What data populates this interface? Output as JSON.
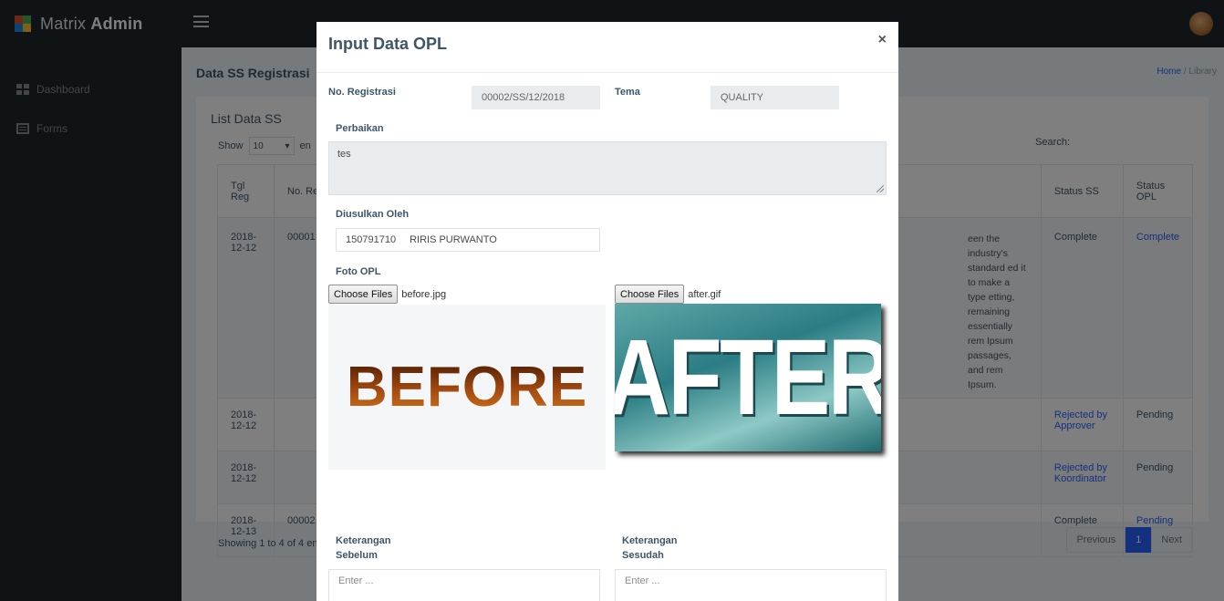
{
  "app": {
    "logo_light": "Matrix",
    "logo_bold": "Admin"
  },
  "sidebar": {
    "items": [
      {
        "label": "Dashboard"
      },
      {
        "label": "Forms"
      }
    ]
  },
  "page": {
    "title": "Data SS Registrasi",
    "breadcrumb": {
      "home": "Home",
      "sep": "/",
      "current": "Library"
    },
    "card_title": "List Data SS",
    "show_label": "Show",
    "entries_value": "10",
    "entries_suffix": "en",
    "search_label": "Search:",
    "table": {
      "headers": [
        "Tgl Reg",
        "No. Re",
        "",
        "Status SS",
        "Status OPL"
      ],
      "rows": [
        {
          "date": "2018-12-12",
          "no": "00001",
          "desc": "een the industry's standard ed it to make a type etting, remaining essentially rem Ipsum passages, and rem Ipsum.",
          "status_ss": "Complete",
          "status_opl": "Complete"
        },
        {
          "date": "2018-12-12",
          "no": "",
          "desc": "",
          "status_ss": "Rejected by Approver",
          "status_opl": "Pending"
        },
        {
          "date": "2018-12-12",
          "no": "",
          "desc": "",
          "status_ss": "Rejected by Koordinator",
          "status_opl": "Pending"
        },
        {
          "date": "2018-12-13",
          "no": "00002",
          "desc": "",
          "status_ss": "Complete",
          "status_opl": "Pending"
        }
      ]
    },
    "showing": "Showing 1 to 4 of 4 en",
    "pager": {
      "prev": "Previous",
      "current": "1",
      "next": "Next"
    }
  },
  "modal": {
    "title": "Input Data OPL",
    "close": "×",
    "no_registrasi_label": "No. Registrasi",
    "no_registrasi_value": "00002/SS/12/2018",
    "tema_label": "Tema",
    "tema_value": "QUALITY",
    "perbaikan_label": "Perbaikan",
    "perbaikan_value": "tes",
    "diusulkan_label": "Diusulkan Oleh",
    "diusulkan_id": "150791710",
    "diusulkan_name": "RIRIS PURWANTO",
    "foto_label": "Foto OPL",
    "choose_files": "Choose Files",
    "file_before": "before.jpg",
    "file_after": "after.gif",
    "image_before_text": "BEFORE",
    "image_after_text": "AFTER",
    "ket_sebelum_label_1": "Keterangan",
    "ket_sebelum_label_2": "Sebelum",
    "ket_sesudah_label_1": "Keterangan",
    "ket_sesudah_label_2": "Sesudah",
    "enter_placeholder": "Enter ..."
  }
}
